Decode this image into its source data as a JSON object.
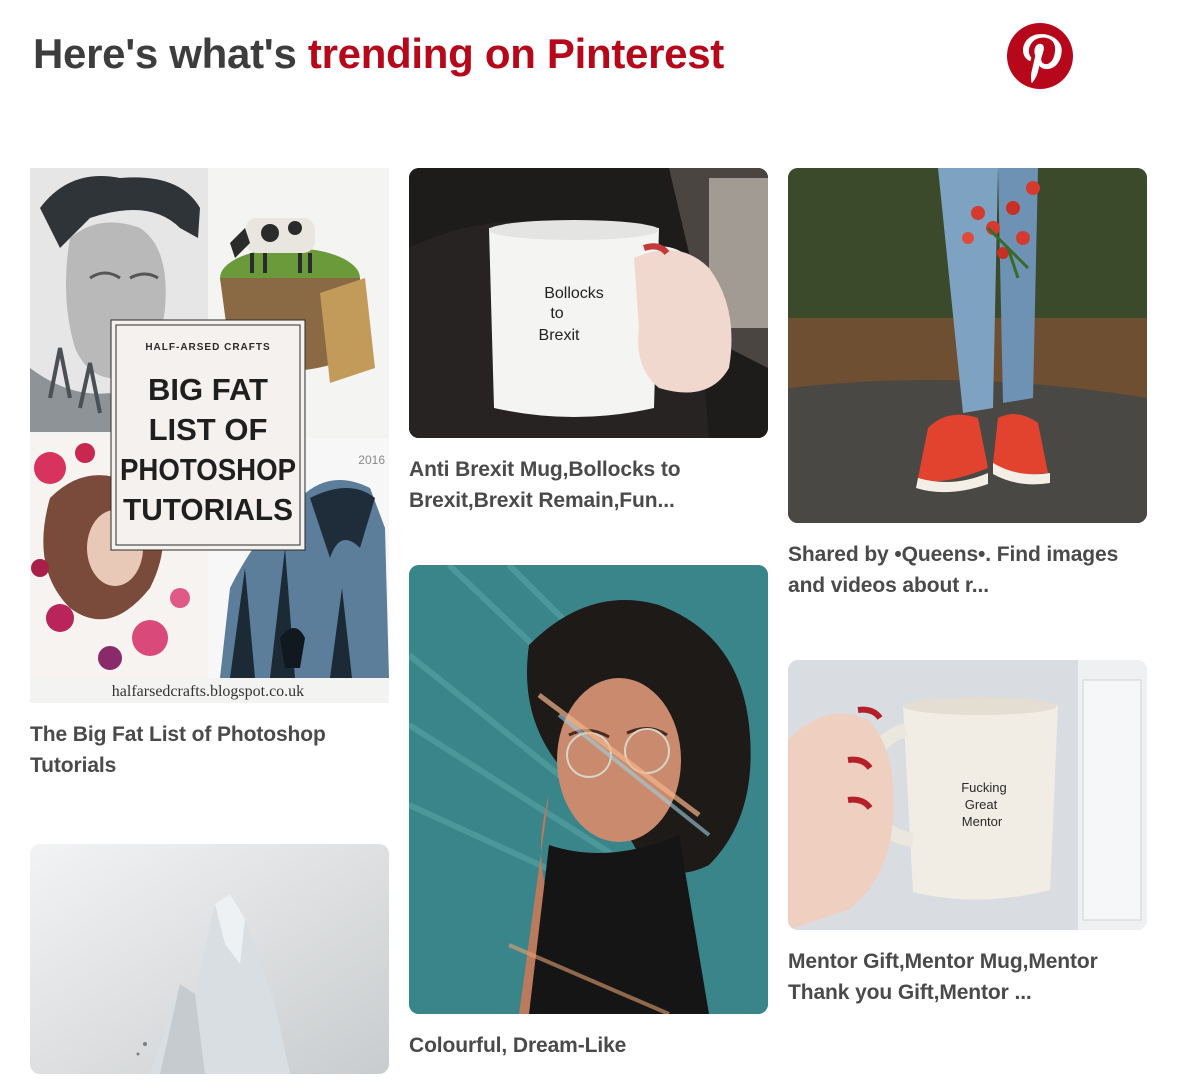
{
  "header": {
    "title_prefix": "Here's what's ",
    "title_accent": "trending on Pinterest",
    "accent_color": "#b7081b",
    "logo_icon": "pinterest-logo-icon"
  },
  "pins": [
    {
      "title": "The Big Fat List of Photoshop Tutorials",
      "image": {
        "brand": "HALF-ARSED CRAFTS",
        "lines": [
          "BIG FAT",
          "LIST OF",
          "PHOTOSHOP",
          "TUTORIALS"
        ],
        "year": "2016",
        "source": "halfarsedcrafts.blogspot.co.uk"
      }
    },
    {
      "title": "Anti Brexit Mug,Bollocks to Brexit,Brexit Remain,Fun...",
      "image": {
        "mug_lines": [
          "Bollocks",
          "to",
          "Brexit"
        ]
      }
    },
    {
      "title": "Shared by     •Queens•. Find images and videos about r..."
    },
    {
      "title": "Colourful, Dream-Like"
    },
    {
      "title": "Mentor Gift,Mentor Mug,Mentor Thank you Gift,Mentor ...",
      "image": {
        "mug_lines": [
          "Fucking",
          "Great",
          "Mentor"
        ]
      }
    },
    {
      "title": ""
    }
  ]
}
